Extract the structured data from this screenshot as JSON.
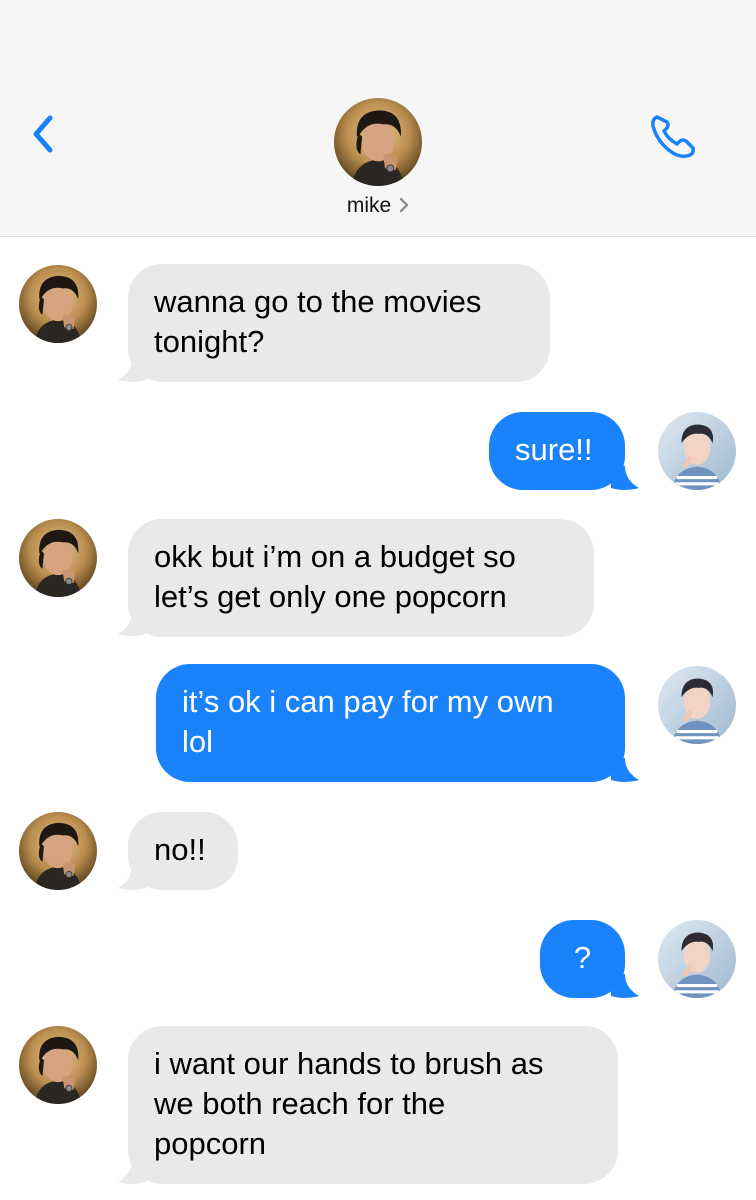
{
  "header": {
    "contact_name": "mike",
    "back_icon": "chevron-left-icon",
    "call_icon": "phone-icon"
  },
  "colors": {
    "sent_bubble": "#1a82fb",
    "received_bubble": "#e9e9eb",
    "accent": "#1a82fb"
  },
  "messages": [
    {
      "from": "mike",
      "direction": "received",
      "lines": [
        "wanna go to the movies",
        "tonight?"
      ]
    },
    {
      "from": "me",
      "direction": "sent",
      "lines": [
        "sure!!"
      ]
    },
    {
      "from": "mike",
      "direction": "received",
      "lines": [
        "okk but i’m on a budget so",
        "let’s get only one popcorn"
      ]
    },
    {
      "from": "me",
      "direction": "sent",
      "lines": [
        "it’s ok i can pay for my own",
        "lol"
      ]
    },
    {
      "from": "mike",
      "direction": "received",
      "lines": [
        "no!!"
      ]
    },
    {
      "from": "me",
      "direction": "sent",
      "lines": [
        "?"
      ]
    },
    {
      "from": "mike",
      "direction": "received",
      "lines": [
        "i want our hands to brush as",
        "we both reach for the",
        "popcorn"
      ]
    }
  ]
}
